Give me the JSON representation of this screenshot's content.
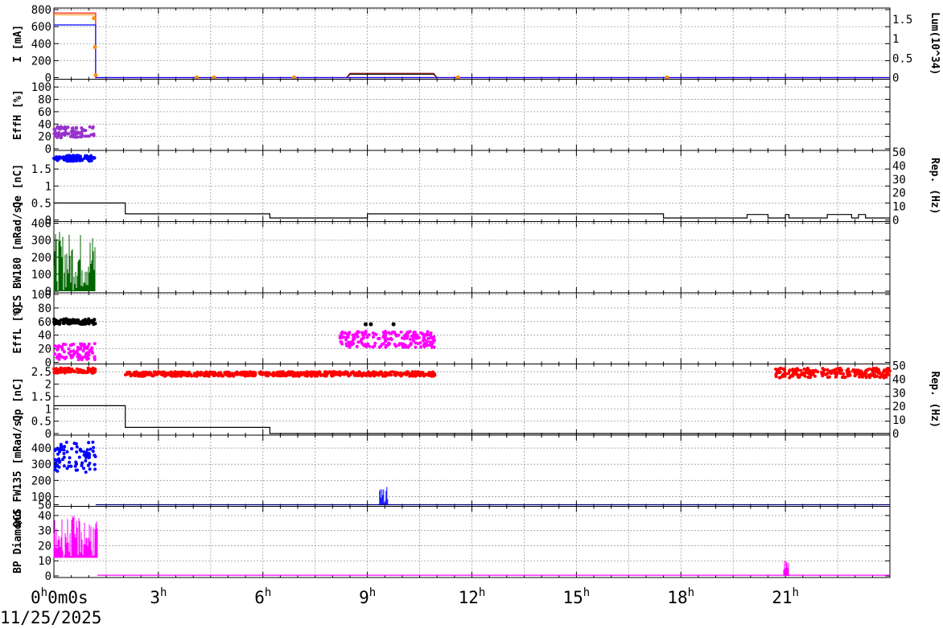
{
  "date": "11/25/2025",
  "chart_data": {
    "type": "line",
    "x_unit": "hours",
    "x_range": [
      0,
      24
    ],
    "x_ticks": [
      {
        "hour": 0,
        "main": "0",
        "sup": "h",
        "tail": "0m0s",
        "tail_sup": ""
      },
      {
        "hour": 3,
        "main": "3",
        "sup": "h",
        "tail": "",
        "tail_sup": ""
      },
      {
        "hour": 6,
        "main": "6",
        "sup": "h",
        "tail": "",
        "tail_sup": ""
      },
      {
        "hour": 9,
        "main": "9",
        "sup": "h",
        "tail": "",
        "tail_sup": ""
      },
      {
        "hour": 12,
        "main": "12",
        "sup": "h",
        "tail": "",
        "tail_sup": ""
      },
      {
        "hour": 15,
        "main": "15",
        "sup": "h",
        "tail": "",
        "tail_sup": ""
      },
      {
        "hour": 18,
        "main": "18",
        "sup": "h",
        "tail": "",
        "tail_sup": ""
      },
      {
        "hour": 21,
        "main": "21",
        "sup": "h",
        "tail": "",
        "tail_sup": ""
      }
    ],
    "panels": [
      {
        "id": "current",
        "ylabel": "I [mA]",
        "ylim": [
          0,
          800
        ],
        "yticks": [
          "0",
          "200",
          "400",
          "600",
          "800"
        ],
        "right_label": "Lum(10^34)",
        "right_ylim": [
          0,
          1.75
        ],
        "right_ticks": [
          "0",
          "0.5",
          "1",
          "1.5"
        ],
        "series": [
          {
            "color": "#ff0000",
            "style": "line",
            "points": [
              [
                0,
                760
              ],
              [
                1.2,
                760
              ],
              [
                1.2,
                0
              ],
              [
                24,
                0
              ]
            ]
          },
          {
            "color": "#0000ff",
            "style": "line",
            "points": [
              [
                0,
                620
              ],
              [
                1.2,
                620
              ],
              [
                1.2,
                0
              ],
              [
                24,
                0
              ]
            ]
          },
          {
            "color": "#ff8c00",
            "style": "line",
            "points": [
              [
                0,
                740
              ],
              [
                1.2,
                740
              ]
            ]
          },
          {
            "color": "#ff8c00",
            "style": "dots",
            "points": [
              [
                1.15,
                700
              ],
              [
                1.18,
                360
              ],
              [
                1.2,
                30
              ],
              [
                4.1,
                2
              ],
              [
                4.6,
                2
              ],
              [
                6.9,
                2
              ],
              [
                11.6,
                2
              ],
              [
                17.6,
                2
              ]
            ]
          },
          {
            "color": "#000000",
            "style": "line",
            "points": [
              [
                8.4,
                0
              ],
              [
                8.5,
                40
              ],
              [
                10.9,
                40
              ],
              [
                11.0,
                0
              ]
            ]
          },
          {
            "color": "#800000",
            "style": "line",
            "points": [
              [
                8.4,
                0
              ],
              [
                8.5,
                50
              ],
              [
                10.9,
                50
              ],
              [
                11.0,
                0
              ]
            ]
          }
        ]
      },
      {
        "id": "effH",
        "ylabel": "EffH [%]",
        "ylim": [
          0,
          110
        ],
        "yticks": [
          "0",
          "20",
          "40",
          "60",
          "80",
          "100"
        ],
        "right_label": "",
        "series": [
          {
            "color": "#9932cc",
            "style": "band",
            "x": [
              0,
              1.2
            ],
            "y": [
              18,
              36
            ]
          }
        ]
      },
      {
        "id": "qe",
        "ylabel": "Qe [nC]",
        "ylim": [
          0,
          2.0
        ],
        "yticks": [
          "0",
          "0.5",
          "1",
          "1.5"
        ],
        "right_label": "Rep. (Hz)",
        "right_ylim": [
          0,
          50
        ],
        "right_ticks": [
          "0",
          "10",
          "20",
          "30",
          "40",
          "50"
        ],
        "series": [
          {
            "color": "#0000ff",
            "style": "band",
            "x": [
              0,
              1.2
            ],
            "y": [
              1.73,
              1.9
            ]
          },
          {
            "color": "#000000",
            "style": "line",
            "axis": "right",
            "points": [
              [
                0,
                12.5
              ],
              [
                2.05,
                12.5
              ],
              [
                2.05,
                4.5
              ],
              [
                6.2,
                4.5
              ],
              [
                6.2,
                1.5
              ],
              [
                9.0,
                1.5
              ],
              [
                9.0,
                4.5
              ],
              [
                17.5,
                4.5
              ],
              [
                17.5,
                1.5
              ],
              [
                19.9,
                1.5
              ],
              [
                19.9,
                4
              ],
              [
                20.5,
                4
              ],
              [
                20.5,
                1.5
              ],
              [
                21.0,
                1.5
              ],
              [
                21.0,
                4
              ],
              [
                21.1,
                4
              ],
              [
                21.1,
                1.5
              ],
              [
                22.2,
                1.5
              ],
              [
                22.2,
                4
              ],
              [
                22.9,
                4
              ],
              [
                22.9,
                1.5
              ],
              [
                23.1,
                1.5
              ],
              [
                23.1,
                4
              ],
              [
                23.3,
                4
              ],
              [
                23.3,
                1.5
              ],
              [
                24,
                1.5
              ]
            ]
          }
        ]
      },
      {
        "id": "qcs_bw180",
        "ylabel": "QCS BW180 [mRad/s]",
        "ylim": [
          0,
          400
        ],
        "yticks": [
          "0",
          "100",
          "200",
          "300",
          "400"
        ],
        "right_label": "",
        "series": [
          {
            "color": "#006400",
            "style": "spikes",
            "x": [
              0,
              1.2
            ],
            "ymin": 0,
            "ymax": 350
          }
        ]
      },
      {
        "id": "effL",
        "ylabel": "EffL [%]",
        "ylim": [
          0,
          100
        ],
        "yticks": [
          "0",
          "20",
          "40",
          "60",
          "80",
          "100"
        ],
        "right_label": "",
        "series": [
          {
            "color": "#000000",
            "style": "band",
            "x": [
              0,
              1.2
            ],
            "y": [
              56,
              64
            ]
          },
          {
            "color": "#ff00ff",
            "style": "band",
            "x": [
              0,
              1.2
            ],
            "y": [
              4,
              28
            ]
          },
          {
            "color": "#ff00ff",
            "style": "band",
            "x": [
              8.2,
              10.95
            ],
            "y": [
              22,
              46
            ]
          },
          {
            "color": "#000000",
            "style": "dots",
            "points": [
              [
                8.95,
                56
              ],
              [
                9.1,
                56
              ],
              [
                9.75,
                56
              ]
            ]
          }
        ]
      },
      {
        "id": "qp",
        "ylabel": "Qp [nC]",
        "ylim": [
          0,
          2.75
        ],
        "yticks": [
          "0",
          "0.5",
          "1",
          "1.5",
          "2",
          "2.5"
        ],
        "right_label": "Rep. (Hz)",
        "right_ylim": [
          0,
          50
        ],
        "right_ticks": [
          "0",
          "10",
          "20",
          "30",
          "40",
          "50"
        ],
        "series": [
          {
            "color": "#ff0000",
            "style": "band",
            "x": [
              0,
              1.2
            ],
            "y": [
              2.45,
              2.65
            ]
          },
          {
            "color": "#ff0000",
            "style": "band",
            "x": [
              2.05,
              10.95
            ],
            "y": [
              2.32,
              2.5
            ]
          },
          {
            "color": "#ff0000",
            "style": "band",
            "x": [
              20.7,
              24
            ],
            "y": [
              2.25,
              2.65
            ]
          },
          {
            "color": "#000000",
            "style": "line",
            "axis": "right",
            "points": [
              [
                0,
                20.5
              ],
              [
                2.05,
                20.5
              ],
              [
                2.05,
                4.5
              ],
              [
                6.2,
                4.5
              ],
              [
                6.2,
                0
              ],
              [
                24,
                0
              ]
            ]
          }
        ]
      },
      {
        "id": "qcs_fw135",
        "ylabel": "QCS FW135 [mRad/s]",
        "ylim": [
          50,
          470
        ],
        "yticks": [
          "50",
          "100",
          "200",
          "300",
          "400"
        ],
        "right_label": "",
        "series": [
          {
            "color": "#0000ff",
            "style": "band",
            "x": [
              0,
              1.2
            ],
            "y": [
              250,
              440
            ]
          },
          {
            "color": "#0000ff",
            "style": "spikes",
            "x": [
              9.35,
              9.6
            ],
            "ymin": 50,
            "ymax": 160
          },
          {
            "color": "#000080",
            "style": "line",
            "points": [
              [
                1.2,
                50
              ],
              [
                24,
                50
              ]
            ]
          }
        ]
      },
      {
        "id": "bp_diamond",
        "ylabel": "BP Diamond",
        "ylim": [
          0,
          45
        ],
        "yticks": [
          "0",
          "10",
          "20",
          "30",
          "40"
        ],
        "right_label": "",
        "series": [
          {
            "color": "#ff00ff",
            "style": "spikes",
            "x": [
              0,
              1.25
            ],
            "ymin": 12,
            "ymax": 40
          },
          {
            "color": "#ff00ff",
            "style": "line",
            "points": [
              [
                1.25,
                0.5
              ],
              [
                24,
                0.5
              ]
            ]
          },
          {
            "color": "#ff00ff",
            "style": "spikes",
            "x": [
              20.95,
              21.1
            ],
            "ymin": 0,
            "ymax": 10
          }
        ]
      }
    ]
  }
}
